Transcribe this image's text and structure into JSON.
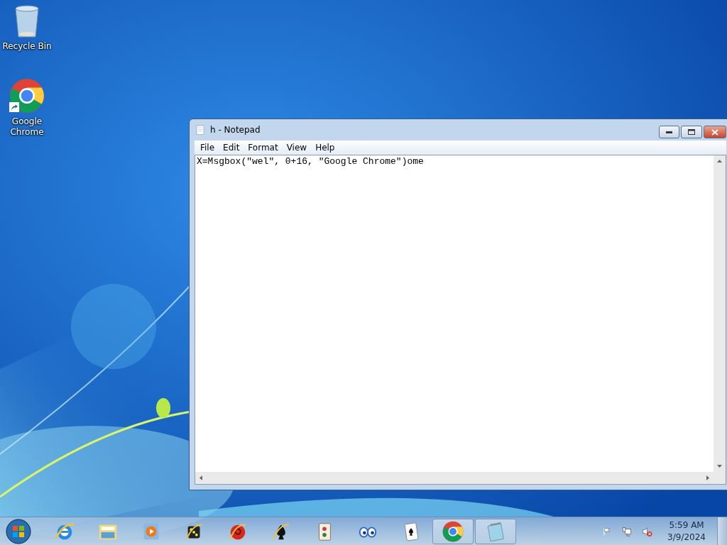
{
  "desktop_icons": [
    {
      "kind": "recycle_bin",
      "label": "Recycle Bin"
    },
    {
      "kind": "chrome",
      "label": "Google Chrome",
      "shortcut": true
    }
  ],
  "window": {
    "title": "h - Notepad",
    "active": true,
    "menu": [
      "File",
      "Edit",
      "Format",
      "View",
      "Help"
    ],
    "text": "X=Msgbox(\"wel\", 0+16, \"Google Chrome\")ome"
  },
  "taskbar": {
    "items": [
      {
        "kind": "ie",
        "open": false
      },
      {
        "kind": "explorer",
        "open": false
      },
      {
        "kind": "media",
        "open": false
      },
      {
        "kind": "dice",
        "open": false
      },
      {
        "kind": "redgame",
        "open": false
      },
      {
        "kind": "spade",
        "open": false
      },
      {
        "kind": "mahjong",
        "open": false
      },
      {
        "kind": "eyes",
        "open": false
      },
      {
        "kind": "cards",
        "open": false
      },
      {
        "kind": "chrome",
        "open": true
      },
      {
        "kind": "notepad",
        "open": true
      }
    ],
    "tray": [
      {
        "kind": "flag"
      },
      {
        "kind": "network"
      },
      {
        "kind": "volume",
        "muted": true
      }
    ],
    "clock": {
      "time": "5:59 AM",
      "date": "3/9/2024"
    }
  }
}
